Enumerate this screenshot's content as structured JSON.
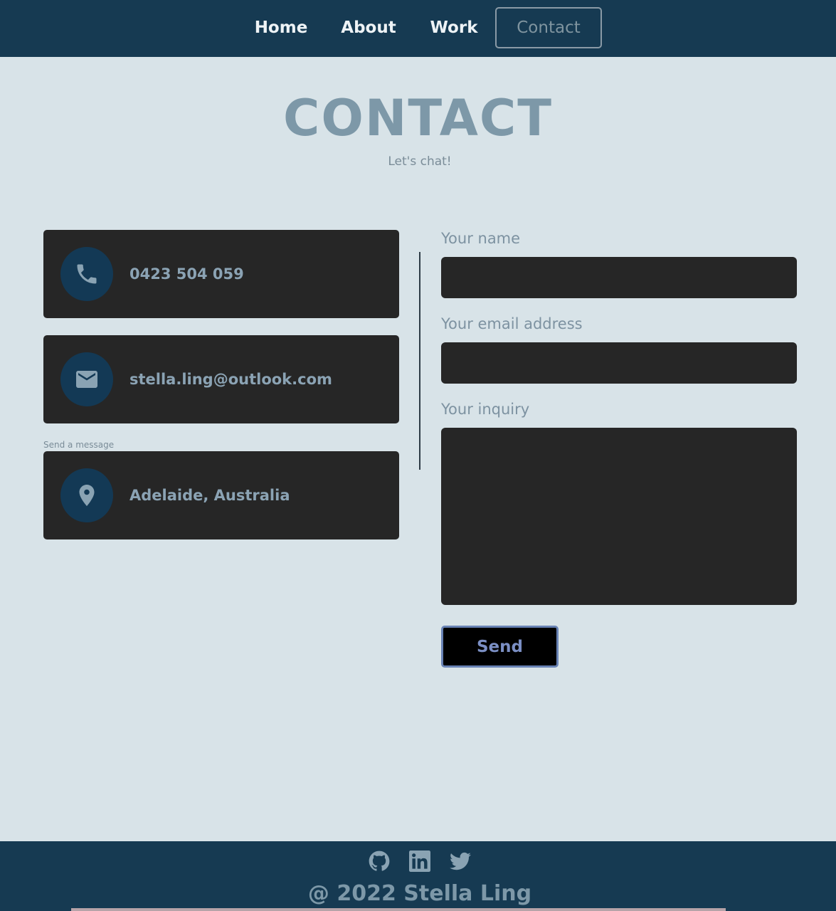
{
  "nav": {
    "home": "Home",
    "about": "About",
    "work": "Work",
    "contact": "Contact"
  },
  "header": {
    "title": "CONTACT",
    "subtitle": "Let's chat!"
  },
  "contact_info": {
    "phone": "0423 504 059",
    "email": "stella.ling@outlook.com",
    "send_message_label": "Send a message",
    "location": "Adelaide, Australia"
  },
  "form": {
    "name_label": "Your name",
    "email_label": "Your email address",
    "inquiry_label": "Your inquiry",
    "name_value": "",
    "email_value": "",
    "inquiry_value": "",
    "send_label": "Send"
  },
  "icons": {
    "phone": "phone-icon",
    "email": "envelope-icon",
    "location": "map-pin-icon",
    "github": "github-icon",
    "linkedin": "linkedin-icon",
    "twitter": "twitter-icon"
  },
  "footer": {
    "copyright": "@ 2022 Stella Ling"
  },
  "colors": {
    "nav_bg": "#163a52",
    "page_bg": "#d8e3e8",
    "card_bg": "#262626",
    "accent": "#7d98a8",
    "send_border": "#6882b4"
  }
}
